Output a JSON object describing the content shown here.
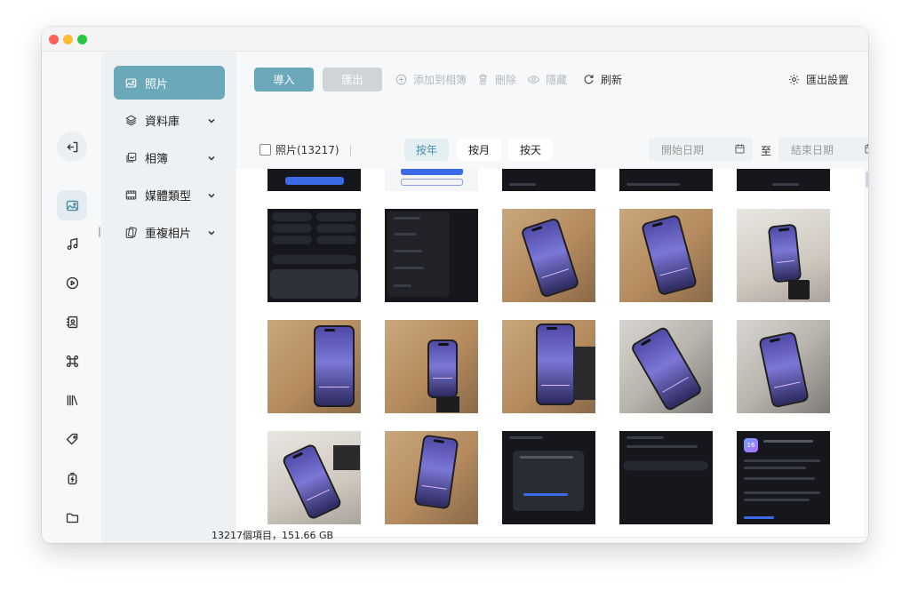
{
  "sidebar": {
    "items": [
      {
        "label": "照片"
      },
      {
        "label": "資料庫"
      },
      {
        "label": "相簿"
      },
      {
        "label": "媒體類型"
      },
      {
        "label": "重複相片"
      }
    ]
  },
  "toolbar": {
    "import_label": "導入",
    "export_label": "匯出",
    "add_album_label": "添加到相簿",
    "delete_label": "刪除",
    "hide_label": "隱藏",
    "refresh_label": "刷新",
    "export_settings_label": "匯出設置"
  },
  "filter": {
    "select_all_label": "照片(13217)",
    "by_year": "按年",
    "by_month": "按月",
    "by_day": "按天",
    "start_date_placeholder": "開始日期",
    "to_label": "至",
    "end_date_placeholder": "結束日期"
  },
  "status": {
    "summary": "13217個項目，151.66 GB"
  },
  "colors": {
    "accent": "#6aa8ba",
    "disabled": "#cfd4d8"
  }
}
